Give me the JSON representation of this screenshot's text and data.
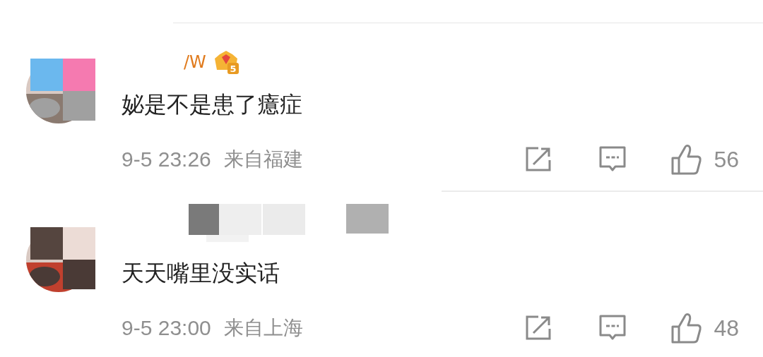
{
  "comments": [
    {
      "username": "/W",
      "vip_level": "5",
      "name_hidden": false,
      "text": "妼是不是患了癔症",
      "time": "9-5 23:26",
      "location": "来自福建",
      "likes": "56"
    },
    {
      "name_hidden": true,
      "text": "天天嘴里没实话",
      "time": "9-5 23:00",
      "location": "来自上海",
      "likes": "48"
    }
  ]
}
